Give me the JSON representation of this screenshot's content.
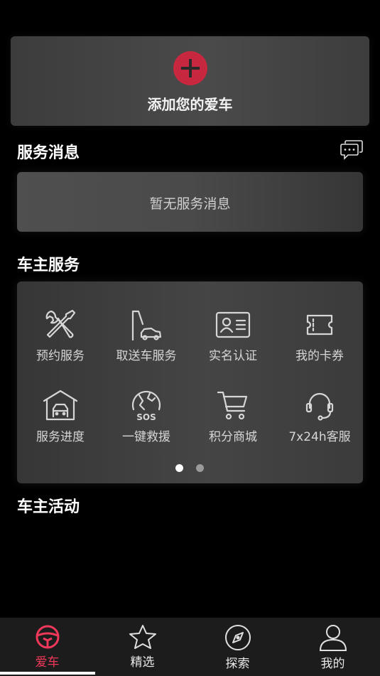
{
  "add_car": {
    "label": "添加您的爱车",
    "accent": "#c8283f"
  },
  "service_messages": {
    "title": "服务消息",
    "empty_text": "暂无服务消息"
  },
  "owner_services": {
    "title": "车主服务",
    "items": [
      {
        "label": "预约服务",
        "icon": "wrench-screwdriver-icon"
      },
      {
        "label": "取送车服务",
        "icon": "car-flag-icon"
      },
      {
        "label": "实名认证",
        "icon": "id-card-icon"
      },
      {
        "label": "我的卡券",
        "icon": "ticket-icon"
      },
      {
        "label": "服务进度",
        "icon": "garage-icon"
      },
      {
        "label": "一键救援",
        "icon": "sos-globe-icon"
      },
      {
        "label": "积分商城",
        "icon": "shopping-cart-icon"
      },
      {
        "label": "7x24h客服",
        "icon": "headset-icon"
      }
    ],
    "pages": 2,
    "current_page": 1
  },
  "owner_activities": {
    "title": "车主活动"
  },
  "tabbar": {
    "active_color": "#f0385a",
    "tabs": [
      {
        "label": "爱车",
        "icon": "steering-wheel-icon",
        "active": true
      },
      {
        "label": "精选",
        "icon": "star-icon",
        "active": false
      },
      {
        "label": "探索",
        "icon": "compass-icon",
        "active": false
      },
      {
        "label": "我的",
        "icon": "user-icon",
        "active": false
      }
    ]
  }
}
